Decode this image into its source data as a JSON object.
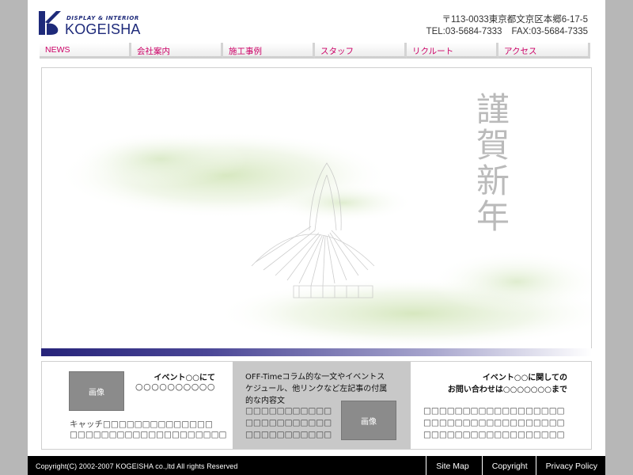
{
  "header": {
    "logo_sub": "DISPLAY & INTERIOR",
    "logo_name": "KOGEISHA",
    "address": "〒113-0033東京都文京区本郷6-17-5",
    "tel": "TEL:03-5684-7333",
    "fax": "FAX:03-5684-7335",
    "colors": {
      "brand": "#1e2a7a",
      "nav_text": "#cc0066"
    }
  },
  "nav": [
    {
      "label": "NEWS"
    },
    {
      "label": "会社案内"
    },
    {
      "label": "施工事例"
    },
    {
      "label": "スタッフ"
    },
    {
      "label": "リクルート"
    },
    {
      "label": "アクセス"
    }
  ],
  "hero": {
    "greeting": [
      "謹",
      "賀",
      "新",
      "年"
    ]
  },
  "panels": {
    "left": {
      "image_label": "画像",
      "title": "イベント○○にて",
      "sub": "○○○○○○○○○○",
      "catch1": "キャッチ□□□□□□□□□□□□□□",
      "catch2": "□□□□□□□□□□□□□□□□□□□□"
    },
    "middle": {
      "line1": "OFF-Timeコラム的な一文やイベントス",
      "line2": "ケジュール、他リンクなど左記事の付属",
      "line3": "的な内容文",
      "body1": "□□□□□□□□□□□",
      "body2": "□□□□□□□□□□□",
      "body3": "□□□□□□□□□□□",
      "image_label": "画像"
    },
    "right": {
      "title": "イベント○○に関しての",
      "sub": "お問い合わせは○○○○○○○まで",
      "body1": "□□□□□□□□□□□□□□□□□□",
      "body2": "□□□□□□□□□□□□□□□□□□",
      "body3": "□□□□□□□□□□□□□□□□□□"
    }
  },
  "footer": {
    "copyright": "Copyright(C) 2002-2007 KOGEISHA co.,ltd All rights Reserved",
    "links": [
      {
        "label": "Site Map"
      },
      {
        "label": "Copyright"
      },
      {
        "label": "Privacy Policy"
      }
    ]
  }
}
